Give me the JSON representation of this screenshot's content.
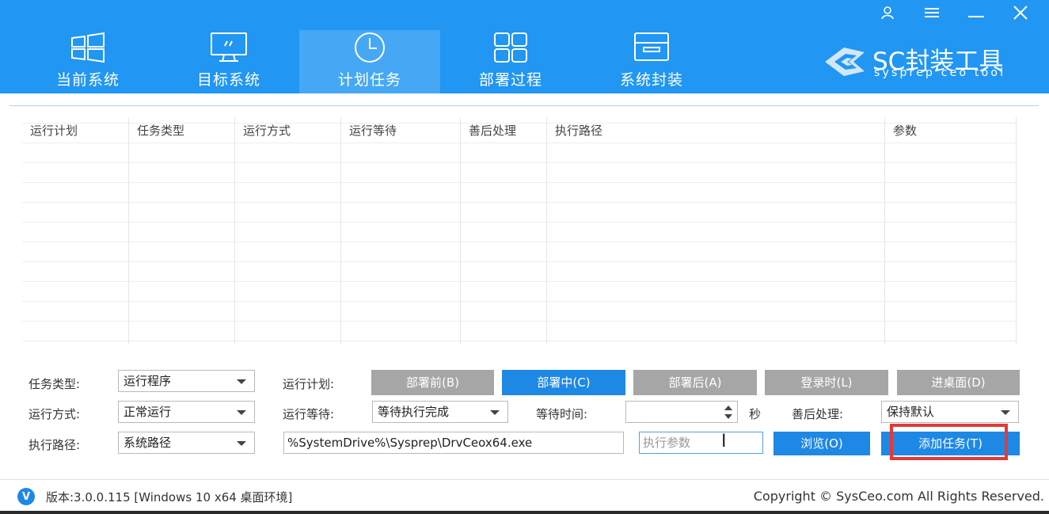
{
  "colors": {
    "header_bg": "#2196f3",
    "active_tab_bg": "#46a8f5",
    "button_blue": "#1e88e5",
    "button_gray": "#a6a6a6",
    "highlight": "#e53935"
  },
  "window_controls": {
    "icons": [
      "user-icon",
      "menu-icon",
      "minimize-icon",
      "close-icon"
    ]
  },
  "nav": {
    "tabs": [
      {
        "label": "当前系统",
        "icon": "windows-icon"
      },
      {
        "label": "目标系统",
        "icon": "monitor-icon"
      },
      {
        "label": "计划任务",
        "icon": "clock-icon",
        "active": true
      },
      {
        "label": "部署过程",
        "icon": "grid-icon"
      },
      {
        "label": "系统封装",
        "icon": "drive-icon"
      }
    ]
  },
  "logo": {
    "title": "SC封装工具",
    "subtitle": "sysprep ceo tool"
  },
  "table": {
    "columns": [
      "运行计划",
      "任务类型",
      "运行方式",
      "运行等待",
      "善后处理",
      "执行路径",
      "参数"
    ],
    "rows": []
  },
  "form": {
    "task_type_label": "任务类型:",
    "task_type_value": "运行程序",
    "run_mode_label": "运行方式:",
    "run_mode_value": "正常运行",
    "exec_path_label": "执行路径:",
    "exec_path_value": "系统路径",
    "schedule_label": "运行计划:",
    "schedule_buttons": [
      {
        "label": "部署前(B)",
        "active": false
      },
      {
        "label": "部署中(C)",
        "active": true
      },
      {
        "label": "部署后(A)",
        "active": false
      },
      {
        "label": "登录时(L)",
        "active": false
      },
      {
        "label": "进桌面(D)",
        "active": false
      }
    ],
    "wait_label": "运行等待:",
    "wait_value": "等待执行完成",
    "wait_time_label": "等待时间:",
    "wait_time_value": "",
    "seconds_unit": "秒",
    "aftercare_label": "善后处理:",
    "aftercare_value": "保持默认",
    "path_input_value": "%SystemDrive%\\Sysprep\\DrvCeox64.exe",
    "params_placeholder": "执行参数",
    "browse_label": "浏览(O)",
    "add_task_label": "添加任务(T)"
  },
  "footer": {
    "version_badge": "V",
    "version_text": "版本:3.0.0.115 [Windows 10 x64 桌面环境]",
    "copyright": "Copyright © SysCeo.com All Rights Reserved."
  }
}
